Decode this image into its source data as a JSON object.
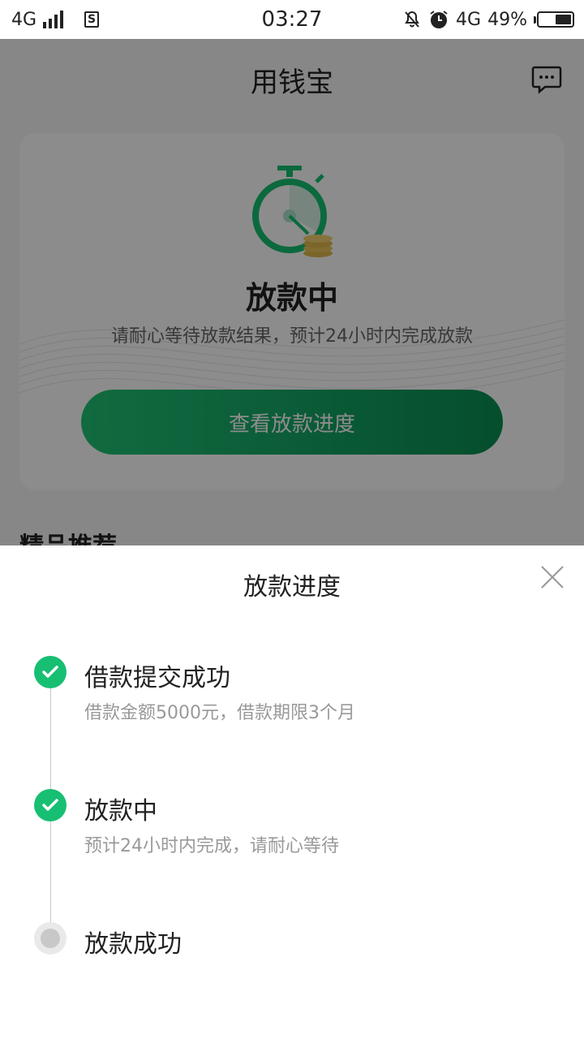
{
  "status_bar": {
    "network": "4G",
    "sim_icon": "S",
    "time": "03:27",
    "network_right": "4G",
    "battery": "49%",
    "battery_level": 0.49,
    "icons": [
      "signal-icon",
      "sim-card-icon",
      "notifications-off-icon",
      "alarm-icon",
      "battery-icon"
    ]
  },
  "header": {
    "title": "用钱宝",
    "chat_icon": "chat-bubble-icon"
  },
  "status_card": {
    "illustration": "stopwatch-coins-icon",
    "title": "放款中",
    "description": "请耐心等待放款结果，预计24小时内完成放款",
    "button_label": "查看放款进度"
  },
  "recommend": {
    "title": "精品推荐"
  },
  "progress_sheet": {
    "title": "放款进度",
    "close_icon": "close-icon",
    "steps": [
      {
        "label": "借款提交成功",
        "detail": "借款金额5000元，借款期限3个月",
        "state": "done"
      },
      {
        "label": "放款中",
        "detail": "预计24小时内完成，请耐心等待",
        "state": "done"
      },
      {
        "label": "放款成功",
        "detail": "",
        "state": "pending"
      }
    ]
  },
  "colors": {
    "accent": "#17bf72",
    "button_start": "#20c474",
    "button_end": "#0a8f52",
    "overlay": "rgba(0,0,0,0.45)"
  }
}
